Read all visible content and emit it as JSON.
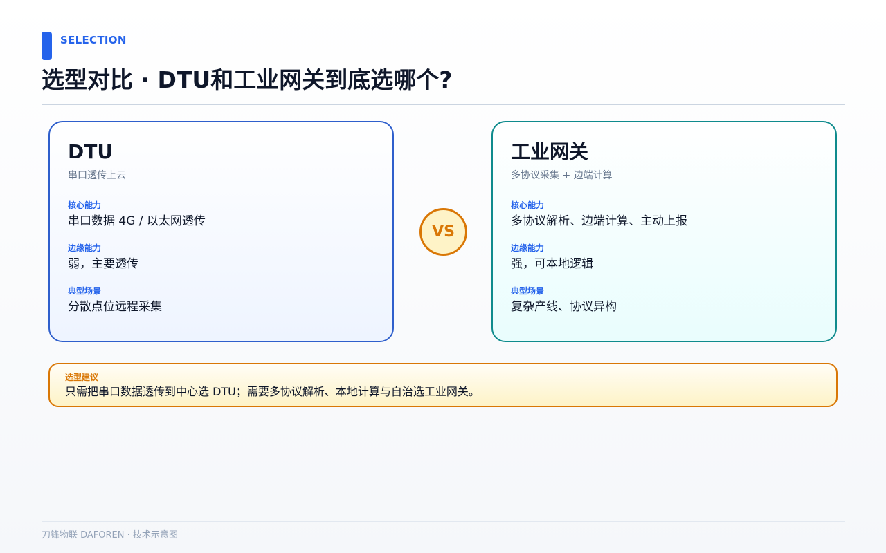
{
  "header": {
    "eyebrow": "SELECTION",
    "title": "选型对比 · DTU和工业网关到底选哪个?"
  },
  "cards": [
    {
      "title": "DTU",
      "subtitle": "串口透传上云",
      "fields": [
        {
          "label": "核心能力",
          "value": "串口数据 4G / 以太网透传"
        },
        {
          "label": "边缘能力",
          "value": "弱，主要透传"
        },
        {
          "label": "典型场景",
          "value": "分散点位远程采集"
        }
      ]
    },
    {
      "title": "工业网关",
      "subtitle": "多协议采集 + 边端计算",
      "fields": [
        {
          "label": "核心能力",
          "value": "多协议解析、边端计算、主动上报"
        },
        {
          "label": "边缘能力",
          "value": "强，可本地逻辑"
        },
        {
          "label": "典型场景",
          "value": "复杂产线、协议异构"
        }
      ]
    }
  ],
  "vs": "VS",
  "tip": {
    "label": "选型建议",
    "text": "只需把串口数据透传到中心选 DTU；需要多协议解析、本地计算与自治选工业网关。"
  },
  "footer": "刀锋物联 DAFOREN · 技术示意图",
  "colors": {
    "primary": "#2563eb",
    "teal": "#0f8b8d",
    "amber": "#d97706",
    "text": "#0f172a",
    "muted": "#64748b"
  }
}
